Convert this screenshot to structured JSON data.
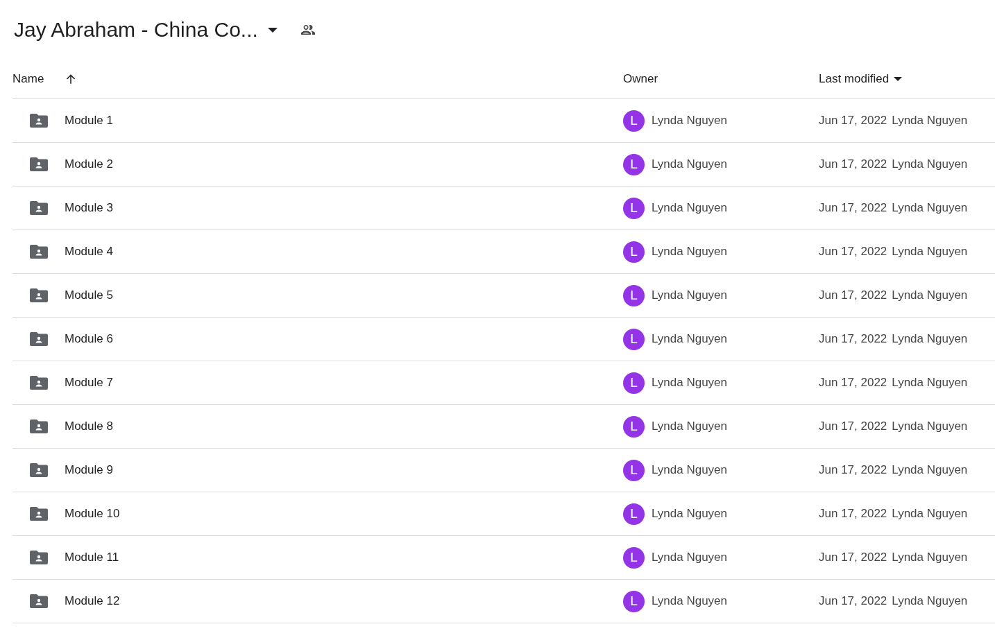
{
  "title": "Jay Abraham - China Co...",
  "columns": {
    "name": "Name",
    "owner": "Owner",
    "modified": "Last modified"
  },
  "rows": [
    {
      "name": "Module 1",
      "avatar_letter": "L",
      "owner": "Lynda Nguyen",
      "date": "Jun 17, 2022",
      "modified_by": "Lynda Nguyen"
    },
    {
      "name": "Module 2",
      "avatar_letter": "L",
      "owner": "Lynda Nguyen",
      "date": "Jun 17, 2022",
      "modified_by": "Lynda Nguyen"
    },
    {
      "name": "Module 3",
      "avatar_letter": "L",
      "owner": "Lynda Nguyen",
      "date": "Jun 17, 2022",
      "modified_by": "Lynda Nguyen"
    },
    {
      "name": "Module 4",
      "avatar_letter": "L",
      "owner": "Lynda Nguyen",
      "date": "Jun 17, 2022",
      "modified_by": "Lynda Nguyen"
    },
    {
      "name": "Module 5",
      "avatar_letter": "L",
      "owner": "Lynda Nguyen",
      "date": "Jun 17, 2022",
      "modified_by": "Lynda Nguyen"
    },
    {
      "name": "Module 6",
      "avatar_letter": "L",
      "owner": "Lynda Nguyen",
      "date": "Jun 17, 2022",
      "modified_by": "Lynda Nguyen"
    },
    {
      "name": "Module 7",
      "avatar_letter": "L",
      "owner": "Lynda Nguyen",
      "date": "Jun 17, 2022",
      "modified_by": "Lynda Nguyen"
    },
    {
      "name": "Module 8",
      "avatar_letter": "L",
      "owner": "Lynda Nguyen",
      "date": "Jun 17, 2022",
      "modified_by": "Lynda Nguyen"
    },
    {
      "name": "Module 9",
      "avatar_letter": "L",
      "owner": "Lynda Nguyen",
      "date": "Jun 17, 2022",
      "modified_by": "Lynda Nguyen"
    },
    {
      "name": "Module 10",
      "avatar_letter": "L",
      "owner": "Lynda Nguyen",
      "date": "Jun 17, 2022",
      "modified_by": "Lynda Nguyen"
    },
    {
      "name": "Module 11",
      "avatar_letter": "L",
      "owner": "Lynda Nguyen",
      "date": "Jun 17, 2022",
      "modified_by": "Lynda Nguyen"
    },
    {
      "name": "Module 12",
      "avatar_letter": "L",
      "owner": "Lynda Nguyen",
      "date": "Jun 17, 2022",
      "modified_by": "Lynda Nguyen"
    }
  ]
}
